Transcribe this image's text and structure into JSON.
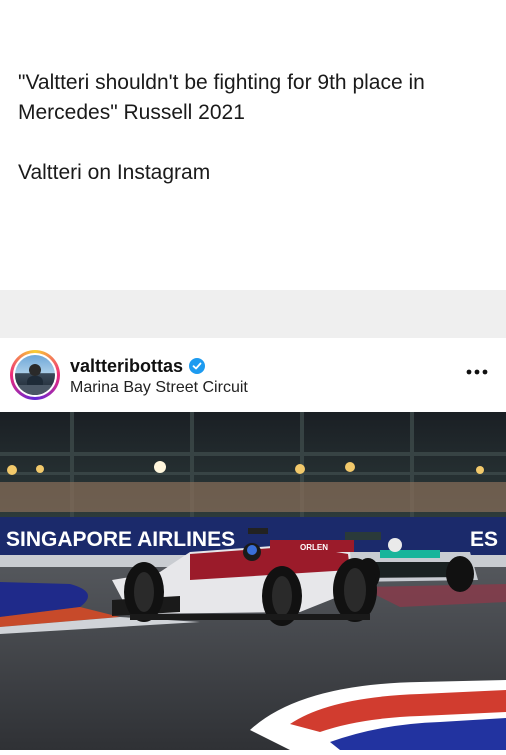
{
  "caption": {
    "line1": "\"Valtteri shouldn't be fighting for 9th place in Mercedes\" Russell 2021",
    "line2": "Valtteri on Instagram"
  },
  "post": {
    "username": "valtteribottas",
    "verified": true,
    "location": "Marina Bay Street Circuit",
    "more_icon": "more-horizontal-icon",
    "photo": {
      "banner_text": "SINGAPORE AIRLINES",
      "banner_text_right": "ES",
      "car_sponsor": "ORLEN"
    }
  },
  "colors": {
    "verified_blue": "#1d9bf0",
    "banner_blue": "#1b2a6b",
    "alfa_red": "#9b1b2a",
    "track": "#3d3f44"
  }
}
